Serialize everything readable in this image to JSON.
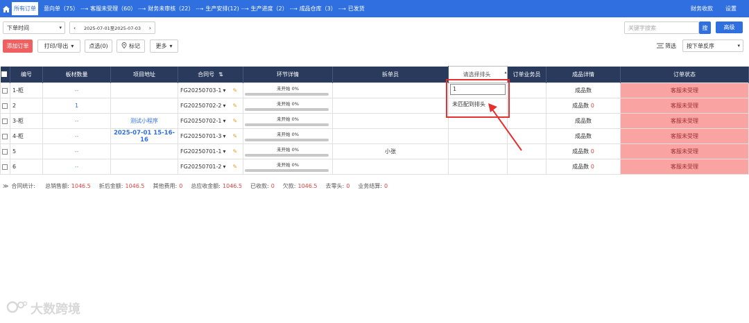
{
  "nav": {
    "active": "所有订单",
    "crumbs": [
      "意向单（75）",
      "客服未受理（60）",
      "财务未审核（22）",
      "生产安排(12)",
      "生产进度（2）",
      "成品仓库（3）",
      "已发货"
    ],
    "right": [
      "财务收款",
      "设置"
    ]
  },
  "filters": {
    "time_select": "下单时间",
    "date_range": "2025-07-01至2025-07-03",
    "search_placeholder": "关键字搜索",
    "search_btn": "搜",
    "advanced": "高级"
  },
  "toolbar": {
    "add": "添加订单",
    "print": "打印/导出",
    "select": "点选(0)",
    "mark": "标记",
    "more": "更多",
    "filter": "筛选",
    "sort": "按下单反序"
  },
  "table": {
    "headers": [
      "编号",
      "板材数量",
      "项目地址",
      "合同号",
      "环节详情",
      "拆单员",
      "请选择排头",
      "订单业务员",
      "成品详情",
      "订单状态"
    ],
    "rows": [
      {
        "id": "1-柜",
        "qty": "--",
        "addr": "",
        "contract": "FG20250703-1",
        "progress": "未开始 0%",
        "splitter": "",
        "head": "",
        "sales": "",
        "product_label": "成品数",
        "product_count": "",
        "status": "客服未受理",
        "qty_link": false,
        "addr_style": ""
      },
      {
        "id": "2",
        "qty": "1",
        "addr": "",
        "contract": "FG20250702-2",
        "progress": "未开始 0%",
        "splitter": "",
        "head": "",
        "sales": "",
        "product_label": "成品数",
        "product_count": "0",
        "status": "客服未受理",
        "qty_link": true,
        "addr_style": ""
      },
      {
        "id": "3-柜",
        "qty": "--",
        "addr": "测试小程序",
        "contract": "FG20250702-1",
        "progress": "未开始 0%",
        "splitter": "",
        "head": "",
        "sales": "",
        "product_label": "成品数",
        "product_count": "",
        "status": "客服未受理",
        "qty_link": false,
        "addr_style": "link"
      },
      {
        "id": "4-柜",
        "qty": "--",
        "addr": "2025-07-01 15-16-16",
        "contract": "FG20250701-3",
        "progress": "未开始 0%",
        "splitter": "",
        "head": "",
        "sales": "",
        "product_label": "成品数",
        "product_count": "",
        "status": "客服未受理",
        "qty_link": false,
        "addr_style": "bold"
      },
      {
        "id": "5",
        "qty": "--",
        "addr": "",
        "contract": "FG20250701-1",
        "progress": "未开始 0%",
        "splitter": "小张",
        "head": "",
        "sales": "",
        "product_label": "成品数",
        "product_count": "0",
        "status": "客服未受理",
        "qty_link": false,
        "addr_style": ""
      },
      {
        "id": "6",
        "qty": "--",
        "addr": "",
        "contract": "FG20250701-2",
        "progress": "未开始 0%",
        "splitter": "",
        "head": "",
        "sales": "",
        "product_label": "成品数",
        "product_count": "0",
        "status": "客服未受理",
        "qty_link": false,
        "addr_style": ""
      }
    ]
  },
  "popup": {
    "input_value": "1",
    "hint": "未匹配到排头"
  },
  "summary": {
    "label": "合同统计:",
    "items": [
      {
        "k": "总销售额:",
        "v": "1046.5"
      },
      {
        "k": "折后金额:",
        "v": "1046.5"
      },
      {
        "k": "其他费用:",
        "v": "0"
      },
      {
        "k": "总应收金额:",
        "v": "1046.5"
      },
      {
        "k": "已收款:",
        "v": "0"
      },
      {
        "k": "欠款:",
        "v": "1046.5"
      },
      {
        "k": "去零头:",
        "v": "0"
      },
      {
        "k": "业务结算:",
        "v": "0"
      }
    ]
  },
  "watermark": "大数跨境",
  "colors": {
    "nav": "#2f6fe0",
    "header": "#293a5c",
    "status_bg": "#f9a3a3",
    "highlight": "#e53030"
  }
}
